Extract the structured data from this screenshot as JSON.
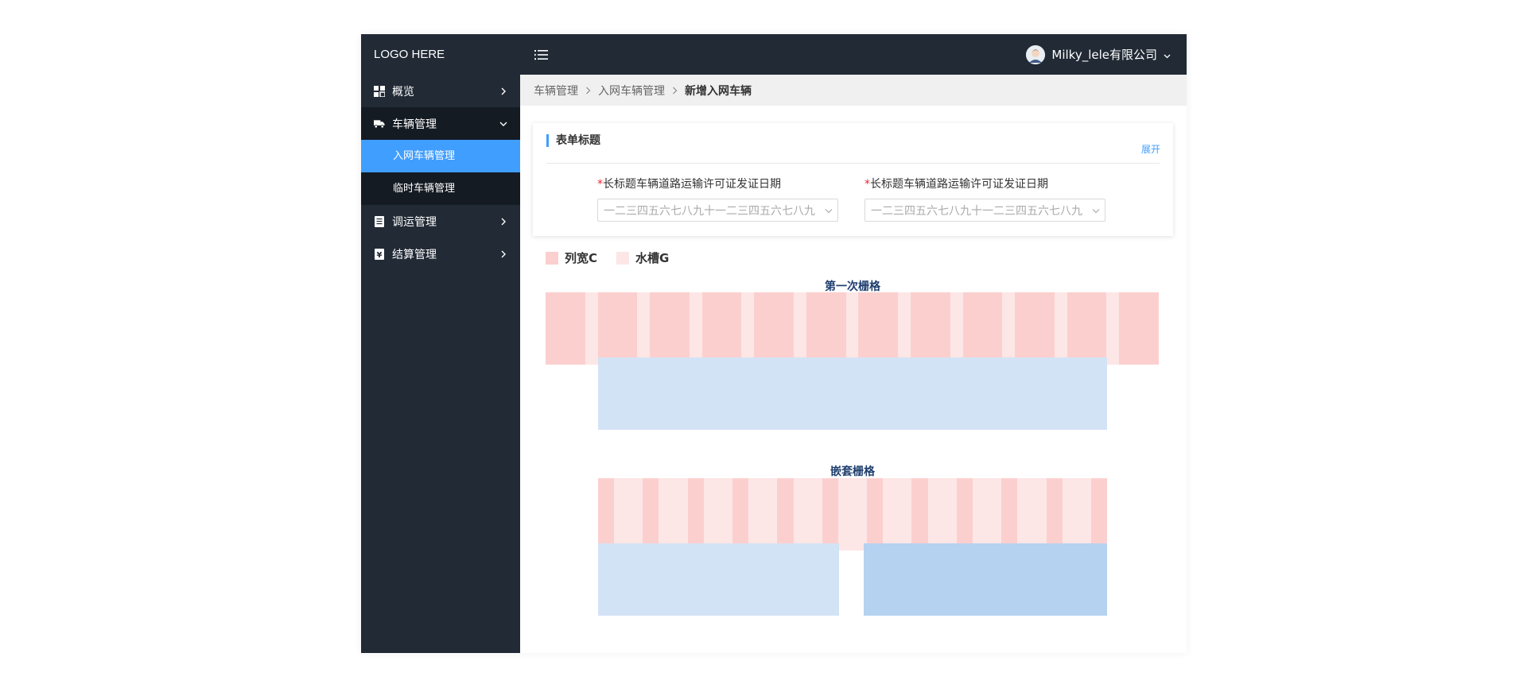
{
  "sidebar": {
    "logo": "LOGO HERE",
    "items": [
      {
        "label": "概览",
        "icon": "dashboard-icon",
        "open": false
      },
      {
        "label": "车辆管理",
        "icon": "truck-icon",
        "open": true,
        "children": [
          {
            "label": "入网车辆管理",
            "active": true
          },
          {
            "label": "临时车辆管理",
            "active": false
          }
        ]
      },
      {
        "label": "调运管理",
        "icon": "clipboard-icon",
        "open": false
      },
      {
        "label": "结算管理",
        "icon": "receipt-icon",
        "open": false
      }
    ]
  },
  "header": {
    "user_name": "Milky_lele有限公司"
  },
  "breadcrumb": [
    "车辆管理",
    "入网车辆管理",
    "新增入网车辆"
  ],
  "form": {
    "title": "表单标题",
    "toggle": "展开",
    "fields": [
      {
        "required": "*",
        "label": "长标题车辆道路运输许可证发证日期",
        "placeholder": "一二三四五六七八九十一二三四五六七八九"
      },
      {
        "required": "*",
        "label": "长标题车辆道路运输许可证发证日期",
        "placeholder": "一二三四五六七八九十一二三四五六七八九"
      }
    ]
  },
  "legend": {
    "column": {
      "label": "列宽C",
      "color": "#fccfcf"
    },
    "gutter": {
      "label": "水槽G",
      "color": "#fde6e6"
    }
  },
  "grids": {
    "first_title": "第一次栅格",
    "nested_title": "嵌套栅格",
    "first_columns": 12,
    "nested_columns": 12,
    "block_color_light": "#d3e3f6",
    "block_color_dark": "#b5d2f1"
  }
}
